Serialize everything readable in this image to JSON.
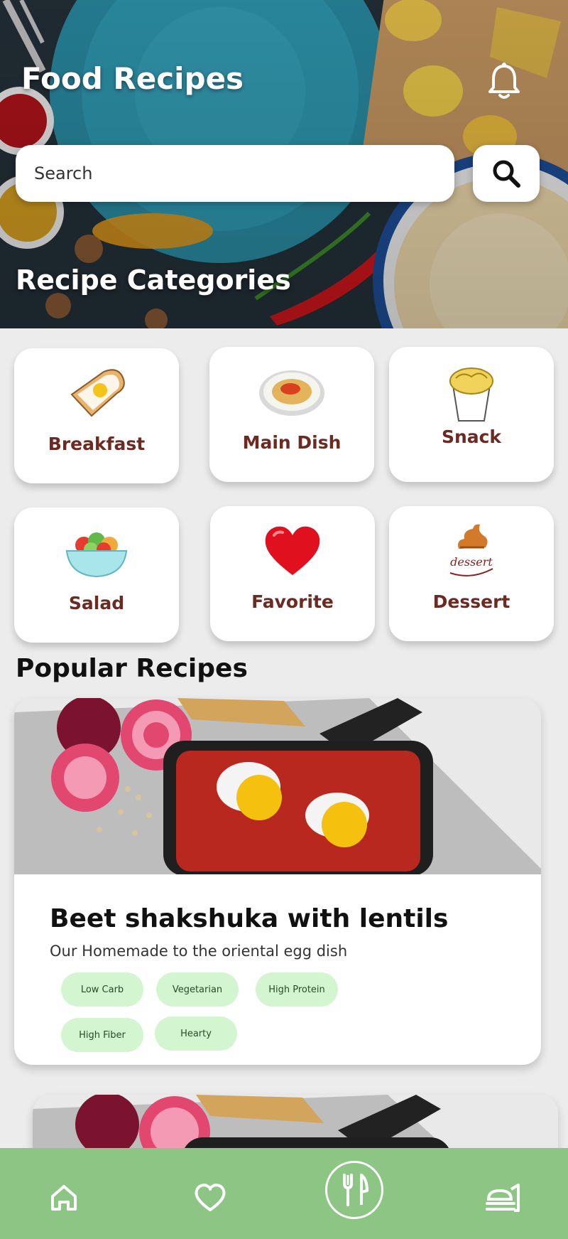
{
  "header": {
    "title": "Food Recipes",
    "notification_icon": "bell-icon"
  },
  "search": {
    "placeholder": "Search",
    "button_icon": "search-icon"
  },
  "categories_section": {
    "title": "Recipe Categories",
    "items": [
      {
        "label": "Breakfast",
        "icon": "toast-egg-icon"
      },
      {
        "label": "Main Dish",
        "icon": "pasta-plate-icon"
      },
      {
        "label": "Snack",
        "icon": "noodle-cup-icon"
      },
      {
        "label": "Salad",
        "icon": "salad-bowl-icon"
      },
      {
        "label": "Favorite",
        "icon": "heart-icon"
      },
      {
        "label": "Dessert",
        "icon": "dessert-icon"
      }
    ]
  },
  "popular_section": {
    "title": "Popular Recipes",
    "recipes": [
      {
        "title": "Beet shakshuka with lentils",
        "subtitle": "Our Homemade to the oriental egg dish",
        "tags": [
          "Low Carb",
          "Vegetarian",
          "High Protein",
          "High Fiber",
          "Hearty"
        ]
      }
    ]
  },
  "bottom_nav": {
    "items": [
      {
        "icon": "home-icon"
      },
      {
        "icon": "heart-outline-icon"
      },
      {
        "icon": "fork-knife-icon"
      },
      {
        "icon": "serving-tray-icon"
      }
    ]
  },
  "colors": {
    "nav_background": "#8dc585",
    "tag_background": "#d3f5cf",
    "category_label": "#6b2a22"
  }
}
